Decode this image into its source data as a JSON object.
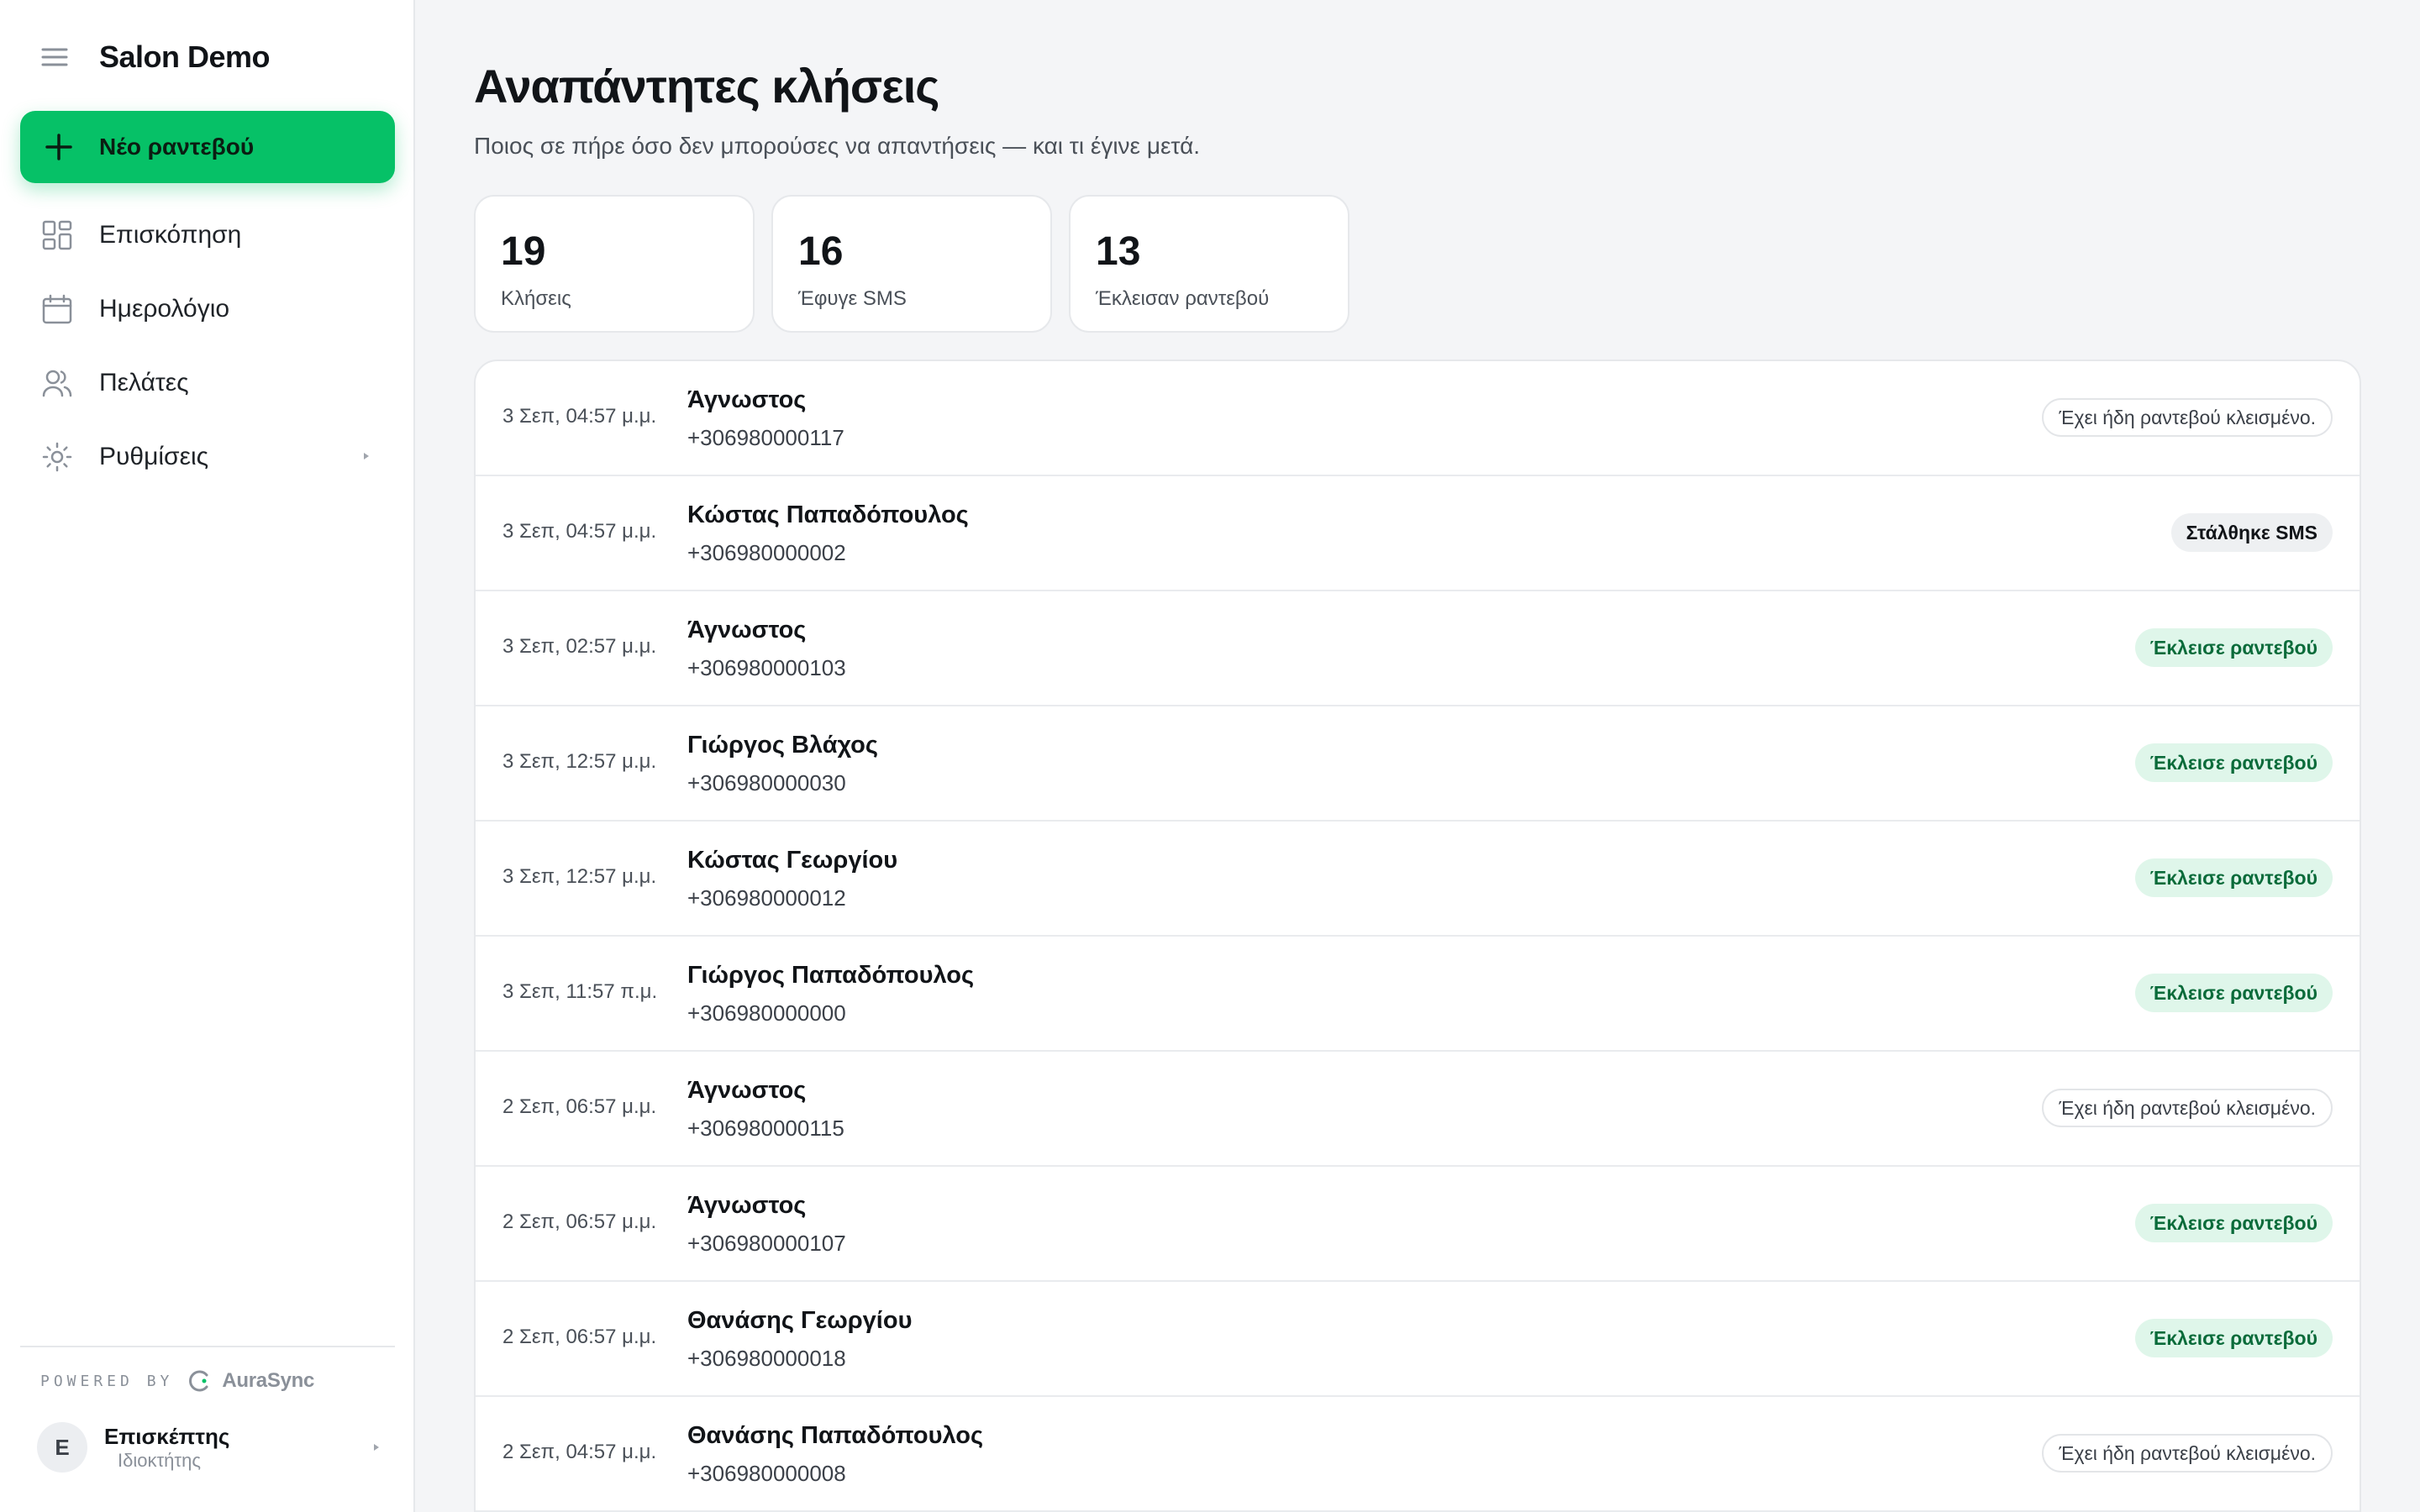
{
  "sidebar": {
    "brand": "Salon Demo",
    "new_button": "Νέο ραντεβού",
    "items": [
      {
        "label": "Επισκόπηση",
        "icon": "grid-icon"
      },
      {
        "label": "Ημερολόγιο",
        "icon": "calendar-icon"
      },
      {
        "label": "Πελάτες",
        "icon": "users-icon"
      },
      {
        "label": "Ρυθμίσεις",
        "icon": "gear-icon"
      }
    ],
    "powered_by": "POWERED BY",
    "powered_brand": "AuraSync",
    "user": {
      "initial": "E",
      "name": "Επισκέπτης",
      "role": "Ιδιοκτήτης"
    }
  },
  "header": {
    "title": "Αναπάντητες κλήσεις",
    "subtitle": "Ποιος σε πήρε όσο δεν μπορούσες να απαντήσεις — και τι έγινε μετά."
  },
  "stats": [
    {
      "value": "19",
      "label": "Κλήσεις"
    },
    {
      "value": "16",
      "label": "Έφυγε SMS"
    },
    {
      "value": "13",
      "label": "Έκλεισαν ραντεβού"
    }
  ],
  "calls": [
    {
      "time": "3 Σεπ, 04:57 μ.μ.",
      "name": "Άγνωστος",
      "phone": "+306980000117",
      "status": "Έχει ήδη ραντεβού κλεισμένο.",
      "status_type": "already"
    },
    {
      "time": "3 Σεπ, 04:57 μ.μ.",
      "name": "Κώστας Παπαδόπουλος",
      "phone": "+306980000002",
      "status": "Στάλθηκε SMS",
      "status_type": "sms"
    },
    {
      "time": "3 Σεπ, 02:57 μ.μ.",
      "name": "Άγνωστος",
      "phone": "+306980000103",
      "status": "Έκλεισε ραντεβού",
      "status_type": "booked"
    },
    {
      "time": "3 Σεπ, 12:57 μ.μ.",
      "name": "Γιώργος Βλάχος",
      "phone": "+306980000030",
      "status": "Έκλεισε ραντεβού",
      "status_type": "booked"
    },
    {
      "time": "3 Σεπ, 12:57 μ.μ.",
      "name": "Κώστας Γεωργίου",
      "phone": "+306980000012",
      "status": "Έκλεισε ραντεβού",
      "status_type": "booked"
    },
    {
      "time": "3 Σεπ, 11:57 π.μ.",
      "name": "Γιώργος Παπαδόπουλος",
      "phone": "+306980000000",
      "status": "Έκλεισε ραντεβού",
      "status_type": "booked"
    },
    {
      "time": "2 Σεπ, 06:57 μ.μ.",
      "name": "Άγνωστος",
      "phone": "+306980000115",
      "status": "Έχει ήδη ραντεβού κλεισμένο.",
      "status_type": "already"
    },
    {
      "time": "2 Σεπ, 06:57 μ.μ.",
      "name": "Άγνωστος",
      "phone": "+306980000107",
      "status": "Έκλεισε ραντεβού",
      "status_type": "booked"
    },
    {
      "time": "2 Σεπ, 06:57 μ.μ.",
      "name": "Θανάσης Γεωργίου",
      "phone": "+306980000018",
      "status": "Έκλεισε ραντεβού",
      "status_type": "booked"
    },
    {
      "time": "2 Σεπ, 04:57 μ.μ.",
      "name": "Θανάσης Παπαδόπουλος",
      "phone": "+306980000008",
      "status": "Έχει ήδη ραντεβού κλεισμένο.",
      "status_type": "already"
    }
  ],
  "colors": {
    "accent": "#06c167",
    "booked_bg": "#dff6ea",
    "booked_text": "#0a6b3a",
    "background": "#f4f5f7"
  }
}
